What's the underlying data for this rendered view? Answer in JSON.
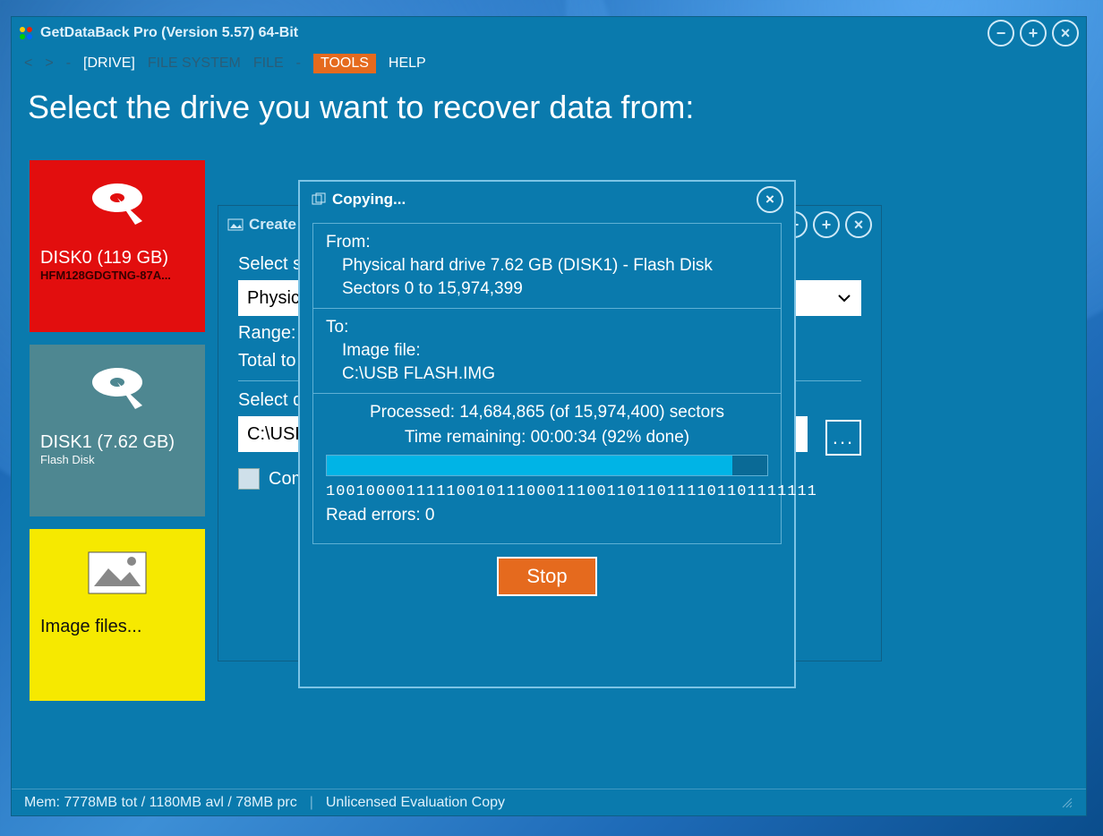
{
  "window": {
    "title": "GetDataBack Pro (Version 5.57) 64-Bit"
  },
  "menu": {
    "back": "<",
    "fwd": ">",
    "sep": "-",
    "drive": "[DRIVE]",
    "filesystem": "FILE SYSTEM",
    "file": "FILE",
    "sep2": "-",
    "tools": "TOOLS",
    "help": "HELP"
  },
  "heading": "Select the drive you want to recover data from:",
  "tiles": {
    "disk0": {
      "label": "DISK0 (119 GB)",
      "sub": "HFM128GDGTNG-87A..."
    },
    "disk1": {
      "label": "DISK1 (7.62 GB)",
      "sub": "Flash Disk"
    },
    "images": {
      "label": "Image files..."
    }
  },
  "create": {
    "title": "Create",
    "select_src": "Select s",
    "src_value": "Physica",
    "range": "Range:",
    "total": "Total to c",
    "select_dst": "Select d",
    "dst_value": "C:\\USB",
    "compress": "Com",
    "browse": "..."
  },
  "copying": {
    "title": "Copying...",
    "from_label": "From:",
    "from_line1": "Physical hard drive 7.62 GB (DISK1) - Flash Disk",
    "from_line2": "Sectors 0 to 15,974,399",
    "to_label": "To:",
    "to_line1": "Image file:",
    "to_line2": "C:\\USB FLASH.IMG",
    "processed": "Processed: 14,684,865 (of 15,974,400) sectors",
    "remaining": "Time remaining: 00:00:34 (92% done)",
    "progress_pct": 92,
    "bits": "1001000011111001011100011100110110111101101111111",
    "read_errors": "Read errors: 0",
    "stop": "Stop"
  },
  "status": {
    "mem": "Mem: 7778MB tot / 1180MB avl / 78MB prc",
    "license": "Unlicensed Evaluation Copy"
  }
}
